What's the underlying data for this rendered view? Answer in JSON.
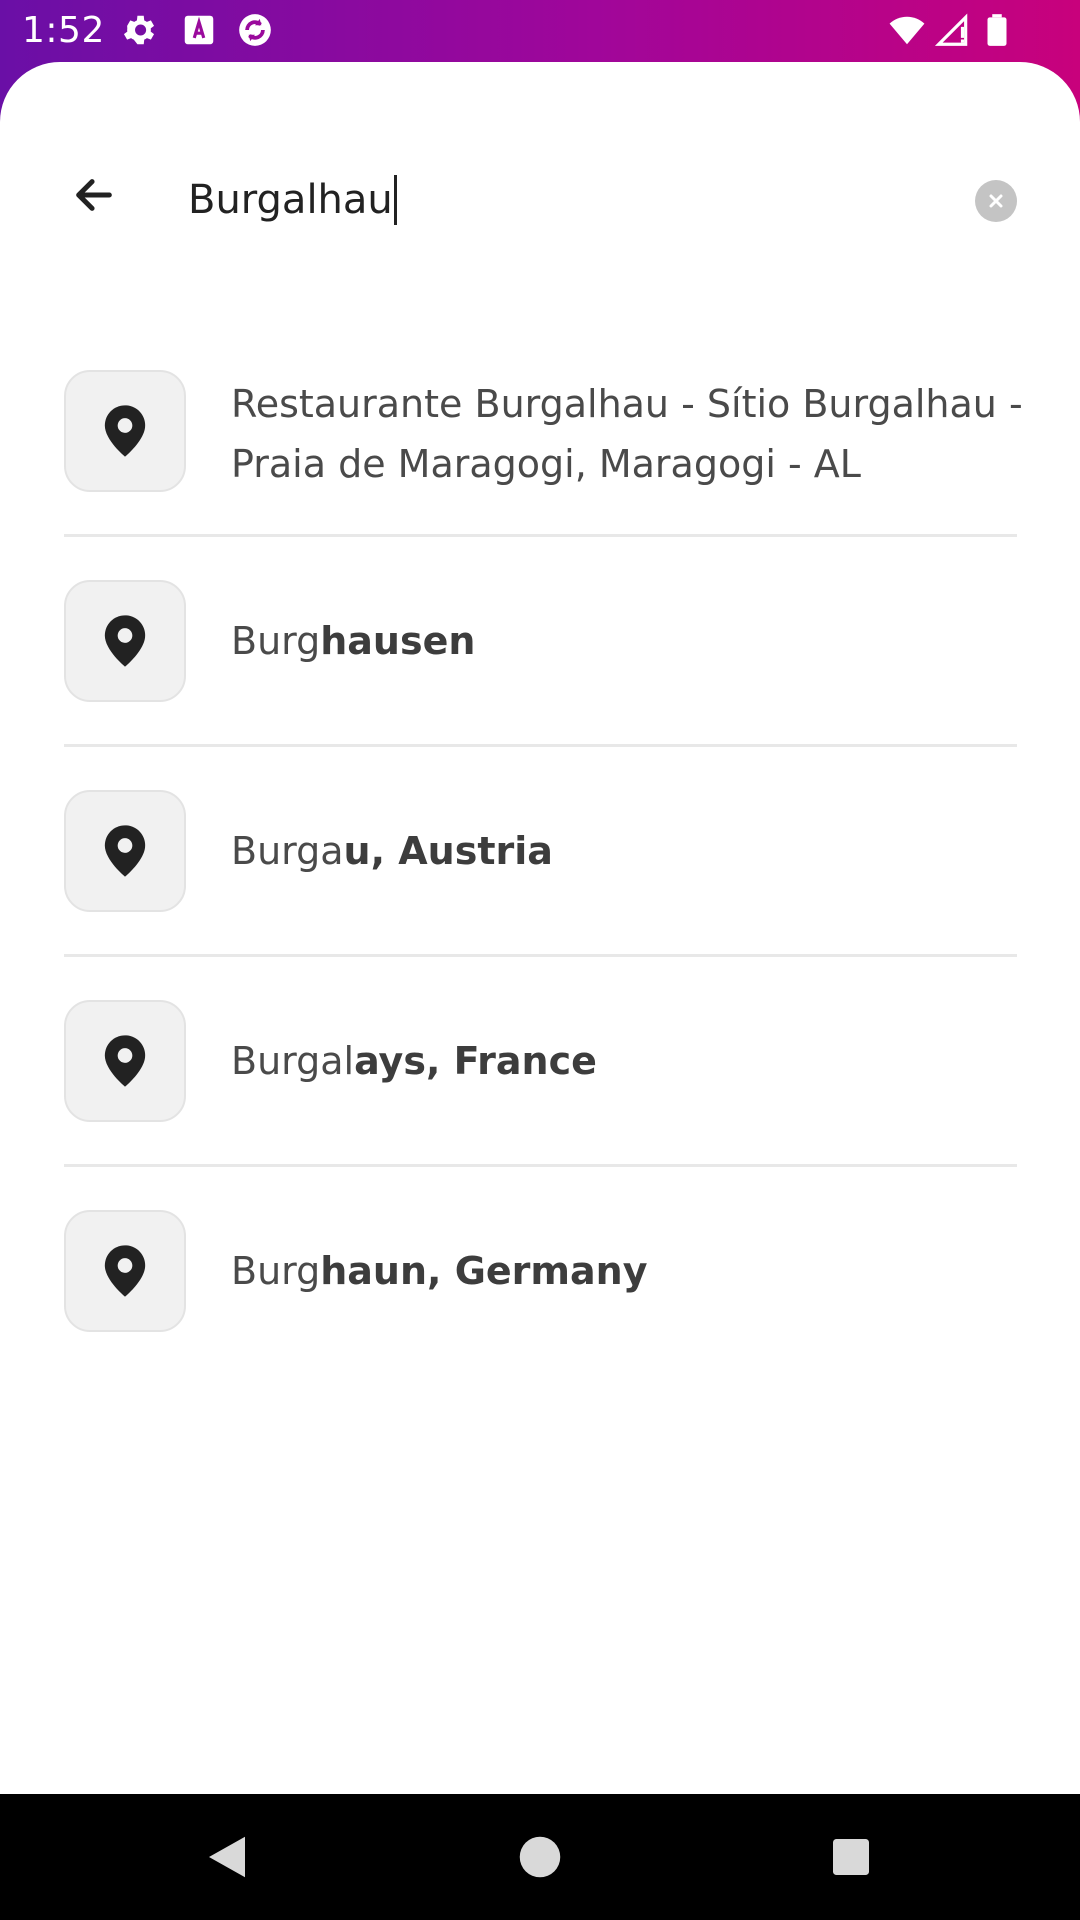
{
  "status_bar": {
    "time": "1:52",
    "icons": [
      "settings-icon",
      "keyboard-a-icon",
      "sync-icon",
      "wifi-icon",
      "signal-icon",
      "battery-icon"
    ]
  },
  "search": {
    "value": "Burgalhau",
    "placeholder": ""
  },
  "results": [
    {
      "icon": "location-pin-icon",
      "line1": "Restaurante Burgalhau - Sítio Burgalhau -",
      "line2": "Praia de Maragogi, Maragogi - AL"
    },
    {
      "icon": "location-pin-icon",
      "plain": "Burg",
      "bold": "hausen"
    },
    {
      "icon": "location-pin-icon",
      "plain": "Burga",
      "bold": "u, Austria"
    },
    {
      "icon": "location-pin-icon",
      "plain": "Burgal",
      "bold": "ays, France"
    },
    {
      "icon": "location-pin-icon",
      "plain": "Burg",
      "bold": "haun, Germany"
    }
  ],
  "nav_bar": {
    "icons": [
      "back-triangle-icon",
      "home-circle-icon",
      "recents-square-icon"
    ]
  },
  "colors": {
    "header_gradient_start": "#6a0fa6",
    "header_gradient_end": "#c8017c",
    "sheet_background": "#ffffff",
    "text_primary": "#4a4a4a",
    "pin_box_background": "#f1f1f1"
  }
}
